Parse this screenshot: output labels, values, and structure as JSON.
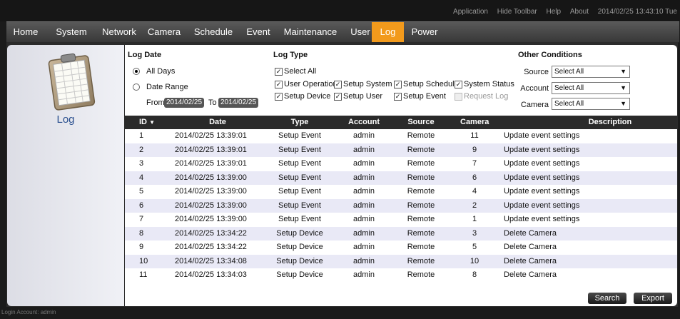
{
  "toolbar": {
    "links": [
      "Application",
      "Hide Toolbar",
      "Help",
      "About"
    ],
    "datetime": "2014/02/25 13:43:10 Tue"
  },
  "menu": {
    "items": [
      "Home",
      "System",
      "Network",
      "Camera",
      "Schedule",
      "Event",
      "Maintenance",
      "User",
      "Log",
      "Power"
    ],
    "active": "Log",
    "accent": "#f29a1c"
  },
  "sidebar": {
    "label": "Log",
    "icon": "clipboard-log-icon"
  },
  "filters": {
    "log_date_title": "Log Date",
    "all_days": "All Days",
    "date_range": "Date Range",
    "from_label": "From",
    "from_value": "2014/02/25",
    "to_label": "To",
    "to_value": "2014/02/25",
    "log_type_title": "Log Type",
    "select_all": "Select All",
    "types": {
      "user_operation": "User Operation",
      "setup_system": "Setup System",
      "setup_schedule": "Setup Schedule",
      "system_status": "System Status",
      "setup_device": "Setup Device",
      "setup_user": "Setup User",
      "setup_event": "Setup Event",
      "request_log": "Request Log"
    },
    "other_title": "Other Conditions",
    "source_label": "Source",
    "source_value": "Select All",
    "account_label": "Account",
    "account_value": "Select All",
    "camera_label": "Camera",
    "camera_value": "Select All"
  },
  "table": {
    "headers": {
      "id": "ID",
      "date": "Date",
      "type": "Type",
      "account": "Account",
      "source": "Source",
      "camera": "Camera",
      "description": "Description"
    },
    "rows": [
      {
        "id": "1",
        "date": "2014/02/25 13:39:01",
        "type": "Setup Event",
        "account": "admin",
        "source": "Remote",
        "camera": "11",
        "description": "Update event settings"
      },
      {
        "id": "2",
        "date": "2014/02/25 13:39:01",
        "type": "Setup Event",
        "account": "admin",
        "source": "Remote",
        "camera": "9",
        "description": "Update event settings"
      },
      {
        "id": "3",
        "date": "2014/02/25 13:39:01",
        "type": "Setup Event",
        "account": "admin",
        "source": "Remote",
        "camera": "7",
        "description": "Update event settings"
      },
      {
        "id": "4",
        "date": "2014/02/25 13:39:00",
        "type": "Setup Event",
        "account": "admin",
        "source": "Remote",
        "camera": "6",
        "description": "Update event settings"
      },
      {
        "id": "5",
        "date": "2014/02/25 13:39:00",
        "type": "Setup Event",
        "account": "admin",
        "source": "Remote",
        "camera": "4",
        "description": "Update event settings"
      },
      {
        "id": "6",
        "date": "2014/02/25 13:39:00",
        "type": "Setup Event",
        "account": "admin",
        "source": "Remote",
        "camera": "2",
        "description": "Update event settings"
      },
      {
        "id": "7",
        "date": "2014/02/25 13:39:00",
        "type": "Setup Event",
        "account": "admin",
        "source": "Remote",
        "camera": "1",
        "description": "Update event settings"
      },
      {
        "id": "8",
        "date": "2014/02/25 13:34:22",
        "type": "Setup Device",
        "account": "admin",
        "source": "Remote",
        "camera": "3",
        "description": "Delete Camera"
      },
      {
        "id": "9",
        "date": "2014/02/25 13:34:22",
        "type": "Setup Device",
        "account": "admin",
        "source": "Remote",
        "camera": "5",
        "description": "Delete Camera"
      },
      {
        "id": "10",
        "date": "2014/02/25 13:34:08",
        "type": "Setup Device",
        "account": "admin",
        "source": "Remote",
        "camera": "10",
        "description": "Delete Camera"
      },
      {
        "id": "11",
        "date": "2014/02/25 13:34:03",
        "type": "Setup Device",
        "account": "admin",
        "source": "Remote",
        "camera": "8",
        "description": "Delete Camera"
      }
    ]
  },
  "buttons": {
    "search": "Search",
    "export": "Export"
  },
  "footer": "Login Account: admin"
}
